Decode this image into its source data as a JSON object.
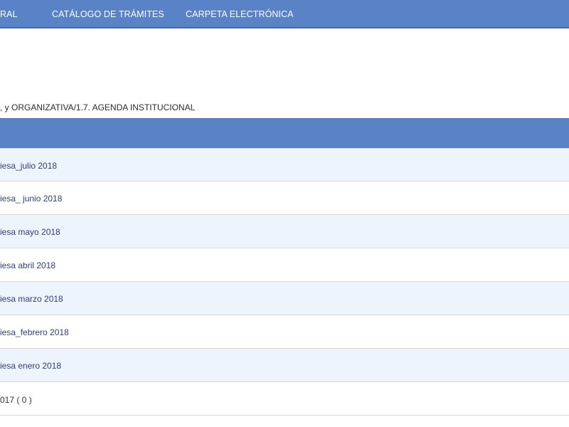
{
  "nav": {
    "items": [
      {
        "label": "RAL"
      },
      {
        "label": "CATÁLOGO DE TRÁMITES"
      },
      {
        "label": "CARPETA ELECTRÓNICA"
      }
    ]
  },
  "breadcrumb": ", y ORGANIZATIVA/1.7. AGENDA INSTITUCIONAL",
  "table": {
    "rows": [
      {
        "label": "iesa_julio 2018"
      },
      {
        "label": "iesa_ junio 2018"
      },
      {
        "label": "iesa mayo 2018"
      },
      {
        "label": "iesa abril 2018"
      },
      {
        "label": "iesa marzo 2018"
      },
      {
        "label": "iesa_febrero 2018"
      },
      {
        "label": "iesa enero 2018"
      },
      {
        "label": "017 ( 0 )"
      }
    ]
  },
  "colors": {
    "header_blue": "#5a82c6",
    "row_alt": "#eef4fb",
    "link": "#2f3e78"
  }
}
